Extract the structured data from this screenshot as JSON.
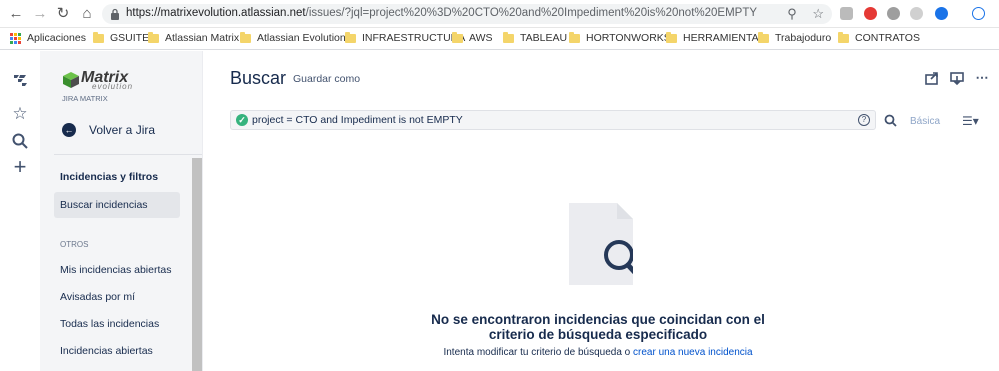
{
  "browser": {
    "url_host": "https://matrixevolution.atlassian.net",
    "url_rest": "/issues/?jql=project%20%3D%20CTO%20and%20Impediment%20is%20not%20EMPTY",
    "bookmarks": [
      {
        "label": "Aplicaciones",
        "icon": "apps-grid-icon"
      },
      {
        "label": "GSUITE",
        "icon": "folder-icon"
      },
      {
        "label": "Atlassian Matrix",
        "icon": "folder-icon"
      },
      {
        "label": "Atlassian Evolution",
        "icon": "folder-icon"
      },
      {
        "label": "INFRAESTRUCTURA",
        "icon": "folder-icon"
      },
      {
        "label": "AWS",
        "icon": "folder-icon"
      },
      {
        "label": "TABLEAU",
        "icon": "folder-icon"
      },
      {
        "label": "HORTONWORKS",
        "icon": "folder-icon"
      },
      {
        "label": "HERRAMIENTAS",
        "icon": "folder-icon"
      },
      {
        "label": "Trabajoduro",
        "icon": "folder-icon"
      },
      {
        "label": "CONTRATOS",
        "icon": "folder-icon"
      }
    ]
  },
  "sidebar": {
    "logo_text": "Matrix",
    "logo_sub": "evolution",
    "project_name": "JIRA MATRIX",
    "back_label": "Volver a Jira",
    "section_heading": "Incidencias y filtros",
    "active_item": "Buscar incidencias",
    "group_label": "OTROS",
    "items": [
      {
        "label": "Mis incidencias abiertas"
      },
      {
        "label": "Avisadas por mí"
      },
      {
        "label": "Todas las incidencias"
      },
      {
        "label": "Incidencias abiertas"
      }
    ]
  },
  "main": {
    "title": "Buscar",
    "save_as": "Guardar como",
    "jql_query": "project = CTO and Impediment is not EMPTY",
    "basic_link": "Básica",
    "empty_title": "No se encontraron incidencias que coincidan con el criterio de búsqueda especificado",
    "empty_hint_prefix": "Intenta modificar tu criterio de búsqueda o",
    "empty_hint_link": "crear una nueva incidencia"
  },
  "colors": {
    "jira_text": "#172b4d",
    "link_blue": "#0052cc",
    "success_green": "#36b37e",
    "sidebar_bg": "#f4f5f7"
  }
}
